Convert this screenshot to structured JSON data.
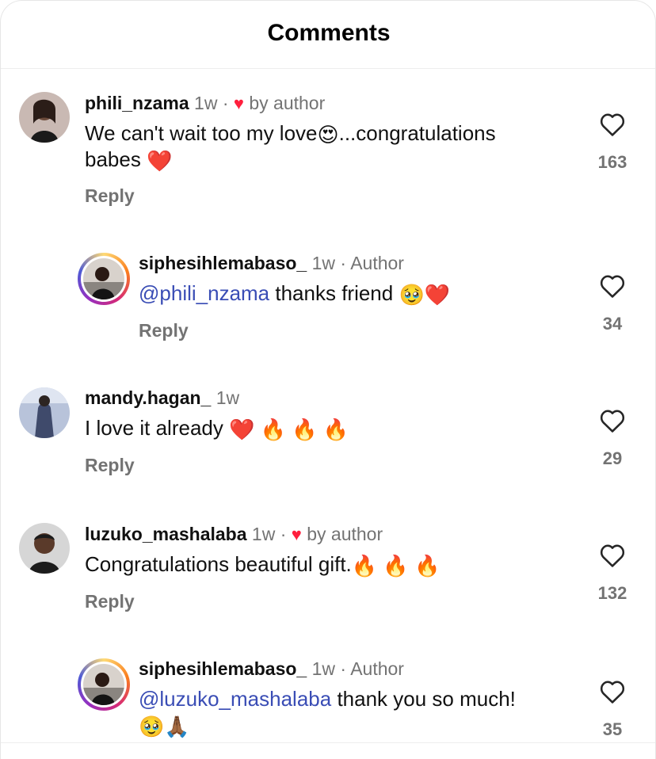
{
  "header": {
    "title": "Comments"
  },
  "comments": [
    {
      "username": "phili_nzama",
      "time": "1w",
      "sep": "·",
      "liked_by": "by author",
      "text_a": "We can't wait too my love",
      "emoji_a": "😍",
      "text_b": "...congratulations",
      "text_c": "babes",
      "emoji_c": "❤️",
      "reply": "Reply",
      "likes": "163"
    },
    {
      "username": "siphesihlemabaso_",
      "time": "1w",
      "sep": "·",
      "badge": "Author",
      "mention": "@phili_nzama",
      "text_a": " thanks friend ",
      "emoji_a": "🥹",
      "emoji_b": "❤️",
      "reply": "Reply",
      "likes": "34"
    },
    {
      "username": "mandy.hagan_",
      "time": "1w",
      "text_a": "I love it already ",
      "emoji_a": "❤️",
      "emoji_b": "🔥",
      "emoji_c": "🔥",
      "emoji_d": "🔥",
      "reply": "Reply",
      "likes": "29"
    },
    {
      "username": "luzuko_mashalaba",
      "time": "1w",
      "sep": "·",
      "liked_by": "by author",
      "text_a": "Congratulations beautiful gift.",
      "emoji_a": "🔥",
      "emoji_b": "🔥",
      "emoji_c": "🔥",
      "reply": "Reply",
      "likes": "132"
    },
    {
      "username": "siphesihlemabaso_",
      "time": "1w",
      "sep": "·",
      "badge": "Author",
      "mention": "@luzuko_mashalaba",
      "text_a": " thank you so much!",
      "emoji_a": "🥹",
      "emoji_b": "🙏🏾",
      "likes": "35"
    }
  ],
  "icons": {
    "like": "heart-outline-icon",
    "liked_by_author": "heart-filled-icon"
  },
  "colors": {
    "mention": "#3a4db5",
    "author_heart": "#ff1f3d",
    "muted": "#737373"
  }
}
